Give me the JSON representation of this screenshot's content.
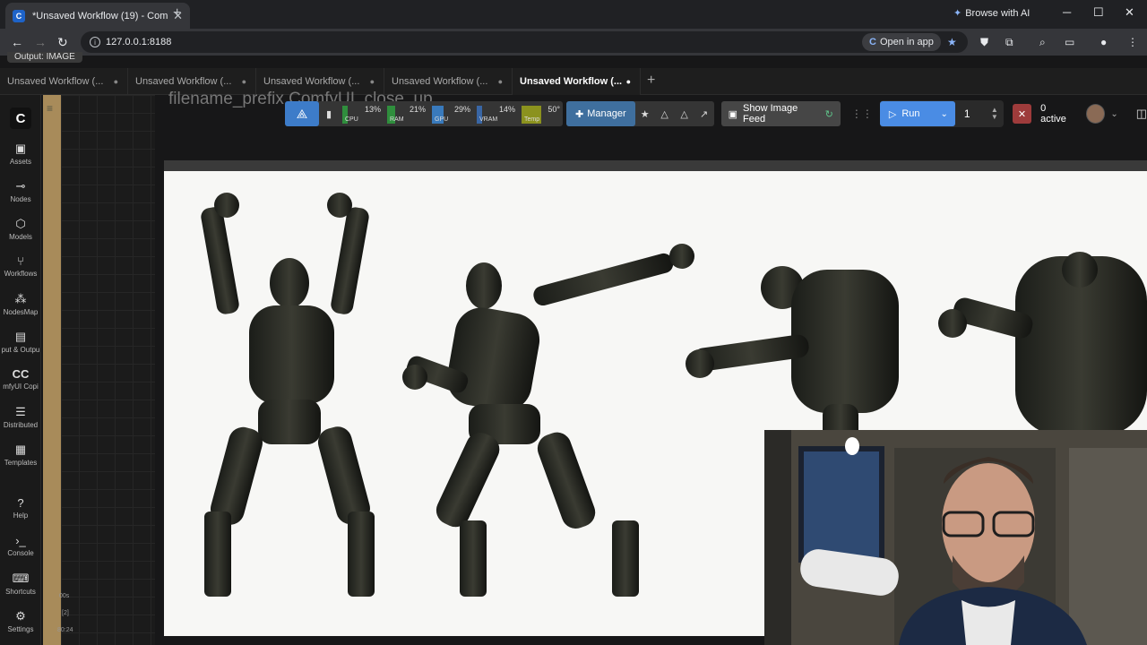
{
  "browser": {
    "tab_title": "*Unsaved Workflow (19) - Com",
    "favicon": "C",
    "browse_ai": "Browse with AI",
    "url": "127.0.0.1:8188",
    "open_in_app": "Open in app"
  },
  "app": {
    "output_chip": "Output: IMAGE",
    "workflow_tabs": [
      {
        "label": "Unsaved Workflow (..."
      },
      {
        "label": "Unsaved Workflow (..."
      },
      {
        "label": "Unsaved Workflow (..."
      },
      {
        "label": "Unsaved Workflow (..."
      },
      {
        "label": "Unsaved Workflow (..."
      }
    ],
    "active_tab_index": 4,
    "sidebar": [
      {
        "label": "Assets",
        "icon": "image-icon"
      },
      {
        "label": "Nodes",
        "icon": "nodes-icon"
      },
      {
        "label": "Models",
        "icon": "models-icon"
      },
      {
        "label": "Workflows",
        "icon": "workflows-icon"
      },
      {
        "label": "NodesMap",
        "icon": "nodesmap-icon"
      },
      {
        "label": "put & Outpu",
        "icon": "io-icon"
      },
      {
        "label": "mfyUI Copi",
        "icon": "copilot-icon"
      },
      {
        "label": "Distributed",
        "icon": "distributed-icon"
      },
      {
        "label": "Templates",
        "icon": "templates-icon"
      },
      {
        "label": "Help",
        "icon": "help-icon"
      },
      {
        "label": "Console",
        "icon": "console-icon"
      },
      {
        "label": "Shortcuts",
        "icon": "keyboard-icon"
      },
      {
        "label": "Settings",
        "icon": "gear-icon"
      }
    ],
    "canvas_bg_text": "filename_prefix      ComfyUI_close_up",
    "metrics": [
      {
        "label": "CPU",
        "value": "13%",
        "level": 0.13,
        "color": "#2e9e3e"
      },
      {
        "label": "RAM",
        "value": "21%",
        "level": 0.21,
        "color": "#2e9e3e"
      },
      {
        "label": "GPU",
        "value": "29%",
        "level": 0.29,
        "color": "#3a86d4"
      },
      {
        "label": "VRAM",
        "value": "14%",
        "level": 0.14,
        "color": "#3a6fb8"
      },
      {
        "label": "Temp",
        "value": "50°",
        "level": 0.5,
        "color": "#9aa21a"
      }
    ],
    "manager_label": "Manager",
    "image_feed_label": "Show Image Feed",
    "run_label": "Run",
    "run_count": "1",
    "active_label": "0 active",
    "bottom_small": [
      "00s",
      "[2]",
      "80:24"
    ]
  }
}
